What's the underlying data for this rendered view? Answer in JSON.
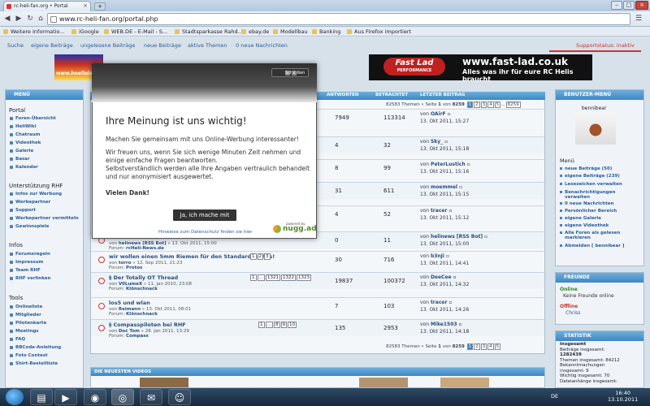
{
  "browser": {
    "tab_title": "rc-heli-fan.org • Portal",
    "url": "www.rc-heli-fan.org/portal.php",
    "bookmarks": [
      "Weitere Informatio...",
      "iGoogle",
      "WEB.DE - E-Mail - S...",
      "Stadtsparkasse Rahd...",
      "ebay.de",
      "Modellbau",
      "Banking",
      "Aus Firefox importiert"
    ]
  },
  "forum_nav": {
    "links": [
      "Suche",
      "eigene Beiträge",
      "ungelesene Beiträge",
      "neue Beiträge",
      "aktive Themen",
      "0 neue Nachrichten"
    ],
    "status": "Supportstatus: inaktiv"
  },
  "banners": {
    "left_text": "www.hoelleisheli",
    "right_logo": "Fast Lad",
    "right_logo_sub": "PERFORMANCE",
    "right_line1": "www.fast-lad.co.uk",
    "right_line2": "Alles was ihr für eure RC Helis braucht"
  },
  "left_menu": {
    "header": "MENÜ",
    "sections": [
      {
        "title": "Portal",
        "items": [
          "Foren-Übersicht",
          "HeliWiki",
          "Chatraum",
          "Videothek",
          "Galerie",
          "Basar",
          "Kalender"
        ]
      },
      {
        "title": "Unterstützung RHF",
        "items": [
          "Infos zur Werbung",
          "Werbepartner",
          "Support",
          "Werbepartner vermitteln",
          "Gewinnspiele"
        ]
      },
      {
        "title": "Infos",
        "items": [
          "Forumsregeln",
          "Impressum",
          "Team RHF",
          "RHF verlinken"
        ]
      },
      {
        "title": "Tools",
        "items": [
          "Onlineliste",
          "Mitglieder",
          "Pilotenkarte",
          "Meetings",
          "FAQ",
          "BBCode-Anleitung",
          "Foto Contest",
          "Shirt-Bestellliste"
        ]
      }
    ]
  },
  "table": {
    "headers": {
      "replies": "ANTWORTEN",
      "views": "BETRACHTET",
      "last": "LETZTER BEITRAG"
    },
    "pagination": {
      "text": "82583 Themen • Seite",
      "current": "1",
      "of": "von",
      "total": "8259",
      "pages": [
        "2",
        "3",
        "4",
        "5",
        "…",
        "8259"
      ]
    },
    "rows": [
      {
        "title": "",
        "sub_pre": "",
        "sub_author": "",
        "sub_date": "",
        "forum": "",
        "replies": "7949",
        "views": "113314",
        "last_by": "OAirF",
        "last_date": "13. Okt 2011, 15:27"
      },
      {
        "title": "",
        "sub_pre": "",
        "sub_author": "",
        "sub_date": "",
        "forum": "",
        "replies": "4",
        "views": "32",
        "last_by": "Sky_",
        "last_date": "13. Okt 2011, 15:18"
      },
      {
        "title": "",
        "sub_pre": "",
        "sub_author": "",
        "sub_date": "",
        "forum": "",
        "replies": "8",
        "views": "99",
        "last_by": "PeterLustich",
        "last_date": "13. Okt 2011, 15:16"
      },
      {
        "title": "",
        "sub_pre": "",
        "sub_author": "",
        "sub_date": "",
        "forum": "",
        "replies": "31",
        "views": "611",
        "last_by": "moemmel",
        "last_date": "13. Okt 2011, 15:15"
      },
      {
        "title": "",
        "sub_pre": "",
        "sub_author": "",
        "sub_date": "",
        "forum": "",
        "replies": "4",
        "views": "52",
        "last_by": "tracer",
        "last_date": "13. Okt 2011, 15:12"
      },
      {
        "title": "",
        "sub_pre": "von",
        "sub_author": "helinews [RSS Bot]",
        "sub_date": "13. Okt 2011, 15:00",
        "forum": "rcHeli-News.de",
        "replies": "0",
        "views": "11",
        "last_by": "helinews [RSS Bot]",
        "last_date": "13. Okt 2011, 15:00"
      },
      {
        "title": "wir wollen einen 5mm Riemen für den Standard Protos!",
        "sub_pre": "von",
        "sub_author": "torro",
        "sub_date": "12. Sep 2011, 21:23",
        "forum": "Protos",
        "replies": "30",
        "views": "716",
        "last_by": "b3nJi",
        "last_date": "13. Okt 2011, 14:41",
        "pages": [
          "1",
          "2",
          "3"
        ]
      },
      {
        "title": "§ Der Totally OT Thread",
        "sub_pre": "von",
        "sub_author": "V0LumeX",
        "sub_date": "11. Jan 2010, 23:08",
        "forum": "Klönschnack",
        "replies": "19837",
        "views": "100372",
        "last_by": "DeeCee",
        "last_date": "13. Okt 2011, 14:32",
        "pages": [
          "1",
          "…",
          "1321",
          "1322",
          "1323"
        ]
      },
      {
        "title": "los5 und wlan",
        "sub_pre": "von",
        "sub_author": "Reimann",
        "sub_date": "13. Okt 2011, 08:01",
        "forum": "Klönschnack",
        "replies": "7",
        "views": "103",
        "last_by": "tracer",
        "last_date": "13. Okt 2011, 14:26"
      },
      {
        "title": "§ Compasspiloten bei RHF",
        "sub_pre": "von",
        "sub_author": "Doc Tom",
        "sub_date": "28. Jan 2011, 13:29",
        "forum": "Compass",
        "replies": "135",
        "views": "2953",
        "last_by": "Mike1503",
        "last_date": "13. Okt 2011, 14:18",
        "pages": [
          "1",
          "…",
          "8",
          "9",
          "10"
        ]
      }
    ],
    "forum_label": "Forum:",
    "pagination_bottom": {
      "text": "82583 Themen • Seite",
      "current": "1",
      "of": "von",
      "total": "8259"
    }
  },
  "newest_videos": {
    "header": "DIE NEUESTEN VIDEOS"
  },
  "right": {
    "user_header": "BENUTZER-MENÜ",
    "username": "bennibear",
    "menu_title": "Menü",
    "menu_items": [
      "neue Beiträge (50)",
      "eigene Beiträge (239)",
      "Lesezeichen verwalten",
      "Benachrichtigungen verwalten",
      "0 neue Nachrichten",
      "Persönlicher Bereich",
      "eigene Galerie",
      "eigene Videothek",
      "Alle Foren als gelesen markieren",
      "Abmelden [ bennibear ]"
    ],
    "friends_header": "FREUNDE",
    "online_label": "Online",
    "online_text": "Keine Freunde online",
    "offline_label": "Offline",
    "offline_name": "Chriss",
    "stats_header": "STATISTIK",
    "stats": [
      "Insgesamt",
      "Beiträge insgesamt:",
      "1282439",
      "Themen insgesamt: 84212",
      "Bekanntmachungen",
      "insgesamt: 9",
      "Wichtig insgesamt: 70",
      "Dateianhänge insgesamt:"
    ]
  },
  "overlay": {
    "close_label": "Schließen",
    "close_x": "x",
    "title": "Ihre Meinung ist uns wichtig!",
    "line1": "Machen Sie gemeinsam mit uns Online-Werbung interessanter!",
    "line2": "Wir freuen uns, wenn Sie sich wenige Minuten Zeit nehmen und",
    "line3": "einige einfache Fragen beantworten.",
    "line4": "Selbstverständlich werden alle Ihre Angaben vertraulich behandelt",
    "line5": "und nur anonymisiert ausgewertet.",
    "thanks": "Vielen Dank!",
    "button": "Ja, ich mache mit",
    "footer": "Hinweise zum Datenschutz finden sie hier",
    "powered": "powered by",
    "brand": "nugg.ad"
  },
  "taskbar": {
    "lang": "DE",
    "time": "16:40",
    "date": "13.10.2011"
  }
}
